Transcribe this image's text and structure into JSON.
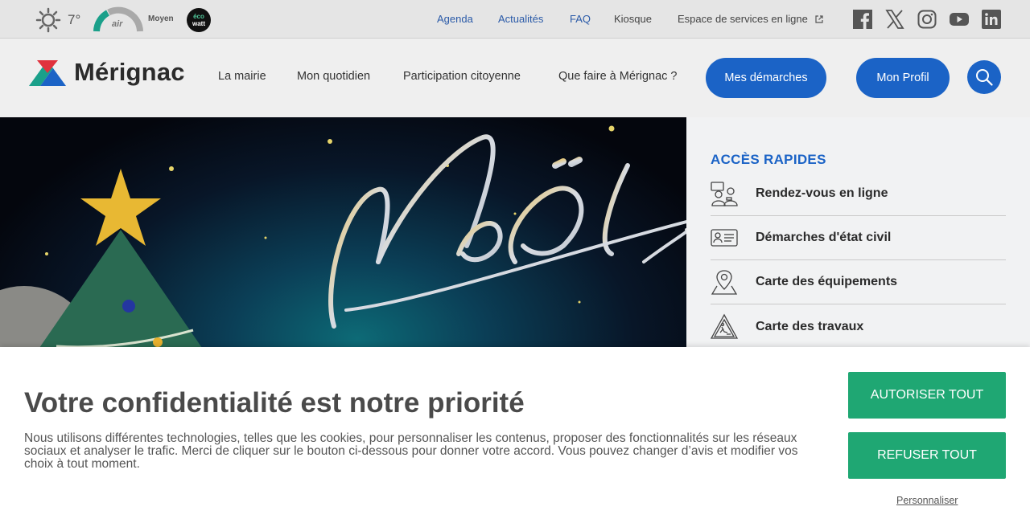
{
  "weather": {
    "icon": "sun-icon",
    "temperature": "7°"
  },
  "air_quality": {
    "label": "air",
    "level": "Moyen",
    "colors": [
      "#1aa08a",
      "#9b9b9b"
    ]
  },
  "ecowatt": {
    "label_top": "éco",
    "label_bottom": "watt"
  },
  "top_links": [
    {
      "label": "Agenda"
    },
    {
      "label": "Actualités"
    },
    {
      "label": "FAQ"
    },
    {
      "label": "Kiosque"
    },
    {
      "label": "Espace de services en ligne"
    }
  ],
  "social": [
    "facebook-icon",
    "x-icon",
    "instagram-icon",
    "youtube-icon",
    "linkedin-icon"
  ],
  "logo": {
    "text": "Mérignac"
  },
  "nav": [
    {
      "label": "La mairie"
    },
    {
      "label": "Mon quotidien"
    },
    {
      "label": "Participation citoyenne"
    },
    {
      "label": "Que faire à Mérignac ?"
    }
  ],
  "header_buttons": {
    "demarches": "Mes démarches",
    "profil": "Mon Profil"
  },
  "hero": {
    "text": "Noël"
  },
  "quick_access": {
    "title": "ACCÈS RAPIDES",
    "items": [
      {
        "label": "Rendez-vous en ligne",
        "icon": "appointment-icon"
      },
      {
        "label": "Démarches d'état civil",
        "icon": "id-card-icon"
      },
      {
        "label": "Carte des équipements",
        "icon": "map-pin-icon"
      },
      {
        "label": "Carte des travaux",
        "icon": "roadwork-icon"
      }
    ]
  },
  "cookie": {
    "title": "Votre confidentialité est notre priorité",
    "text": "Nous utilisons différentes technologies, telles que les cookies, pour personnaliser les contenus, proposer des fonctionnalités sur les réseaux sociaux et analyser le trafic. Merci de cliquer sur le bouton ci-dessous pour donner votre accord. Vous pouvez changer d’avis et modifier vos choix à tout moment.",
    "accept": "AUTORISER TOUT",
    "refuse": "REFUSER TOUT",
    "customize": "Personnaliser"
  },
  "colors": {
    "primary_blue": "#1b63c6",
    "link_blue": "#2a5aa8",
    "accept_green": "#1fa773"
  }
}
